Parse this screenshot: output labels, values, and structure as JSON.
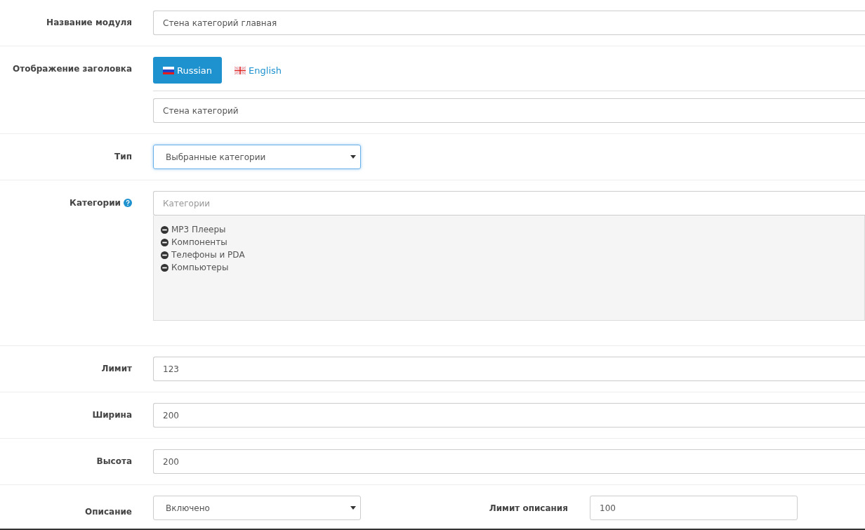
{
  "rows": [
    {
      "kind": "text",
      "label": "Название модуля",
      "value": "Стена категорий главная"
    },
    {
      "kind": "lang",
      "label": "Отображение заголовка",
      "tabs": [
        {
          "label": "Russian",
          "kind": "ru",
          "selected": true
        },
        {
          "label": "English",
          "kind": "gb",
          "selected": false
        }
      ],
      "value": "Стена категорий"
    },
    {
      "kind": "select",
      "label": "Тип",
      "value": "Выбранные категории"
    },
    {
      "kind": "categories",
      "label": "Категории",
      "help": true,
      "placeholder": "Категории",
      "items": [
        "MP3 Плееры",
        "Компоненты",
        "Телефоны и PDA",
        "Компьютеры"
      ]
    },
    {
      "kind": "text",
      "label": "Лимит",
      "value": "123"
    },
    {
      "kind": "text",
      "label": "Ширина",
      "value": "200"
    },
    {
      "kind": "text",
      "label": "Высота",
      "value": "200"
    },
    {
      "kind": "split",
      "label": "Описание",
      "value": "Включено",
      "label2": "Лимит описания",
      "value2": "100"
    }
  ]
}
